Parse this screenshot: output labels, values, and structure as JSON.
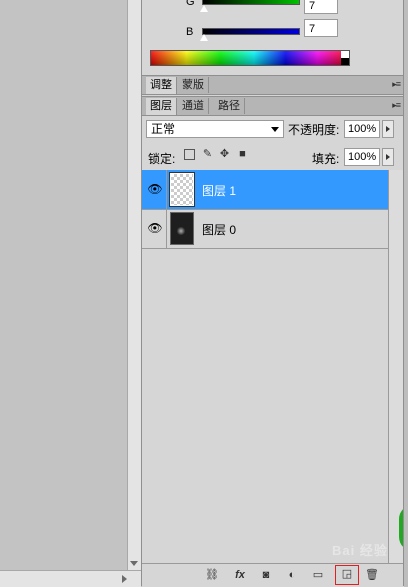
{
  "color_panel": {
    "g": {
      "label": "G",
      "value": "7"
    },
    "b": {
      "label": "B",
      "value": "7"
    }
  },
  "adjust_tabs": {
    "tabs": [
      {
        "label": "调整"
      },
      {
        "label": "蒙版"
      }
    ]
  },
  "layers_tabs": {
    "tabs": [
      {
        "label": "图层"
      },
      {
        "label": "通道"
      },
      {
        "label": "路径"
      }
    ]
  },
  "layers_panel": {
    "blend_mode": "正常",
    "opacity_label": "不透明度:",
    "opacity_value": "100%",
    "lock_label": "锁定:",
    "fill_label": "填充:",
    "fill_value": "100%",
    "layers": [
      {
        "name": "图层 1",
        "selected": true
      },
      {
        "name": "图层 0",
        "selected": false
      }
    ]
  },
  "watermark": "Bai 经验",
  "colors": {
    "selection": "#3399ff",
    "panel_bg": "#d6d6d6"
  }
}
